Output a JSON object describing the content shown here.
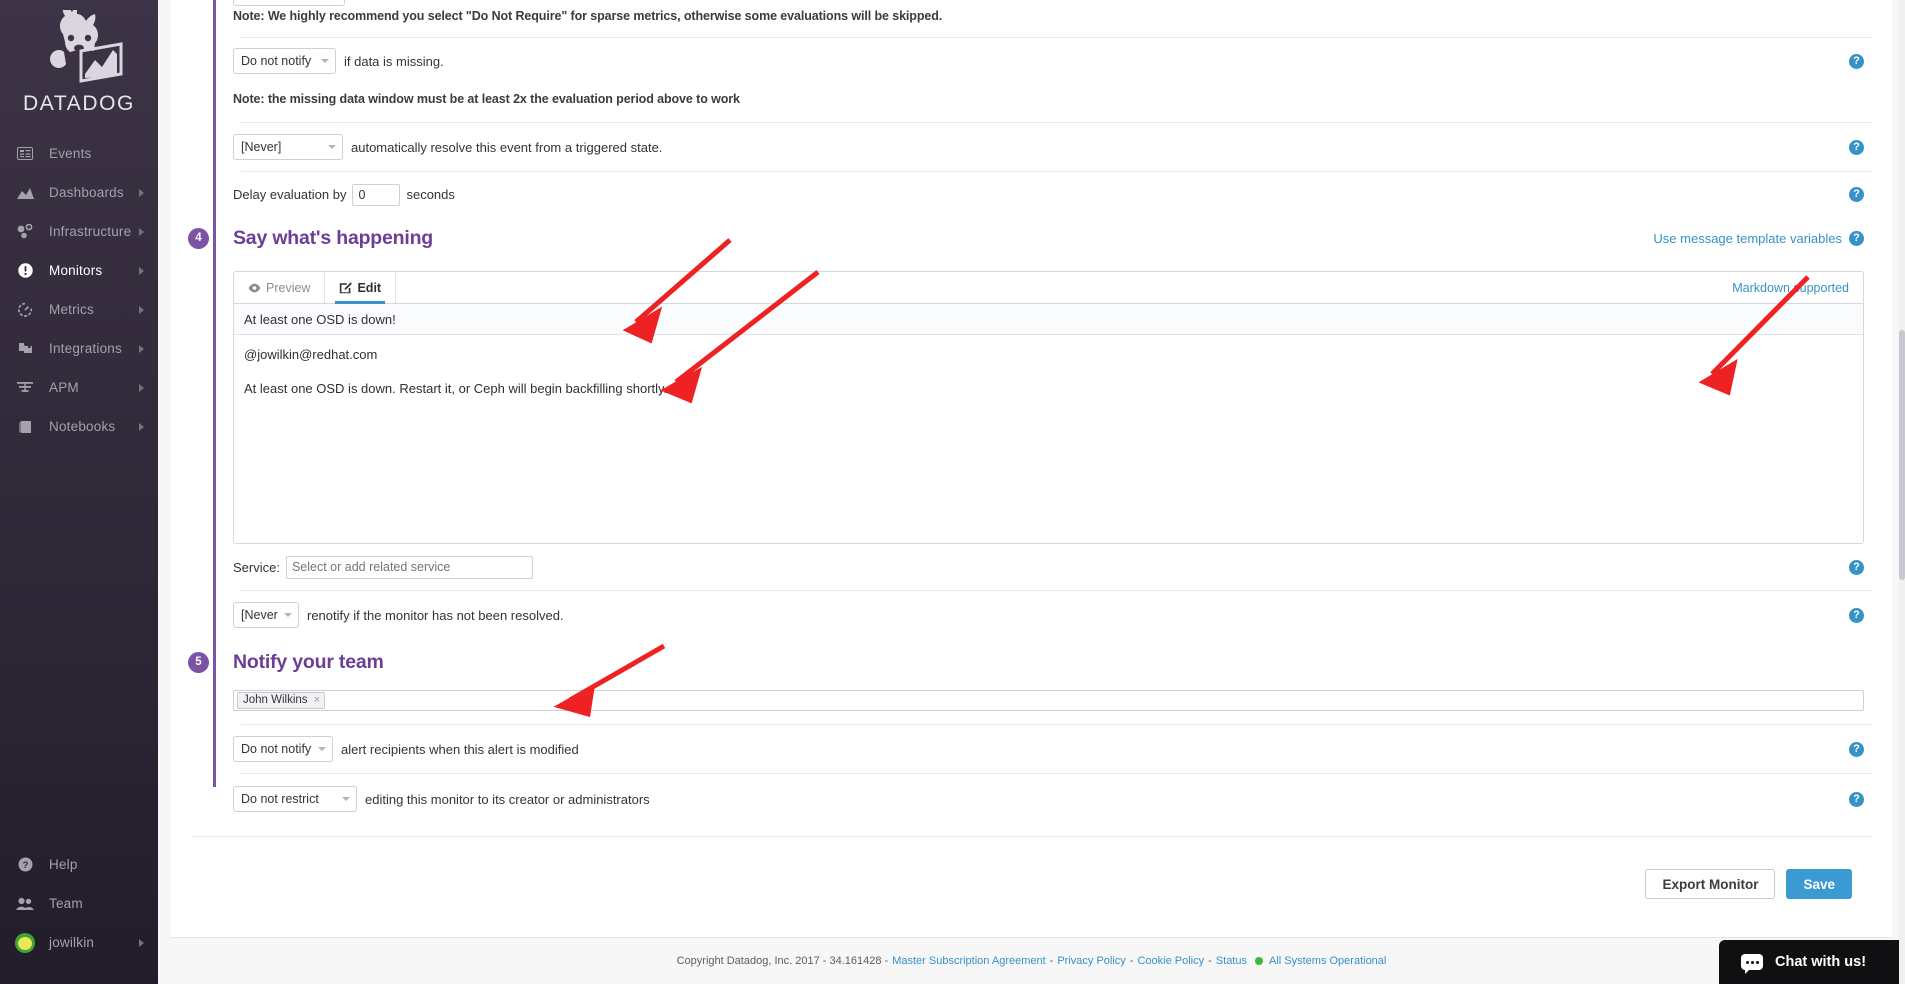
{
  "sidebar": {
    "brand": "DATADOG",
    "items": [
      {
        "label": "Events",
        "icon": "events-icon",
        "has_caret": false,
        "active": false
      },
      {
        "label": "Dashboards",
        "icon": "dashboards-icon",
        "has_caret": true,
        "active": false
      },
      {
        "label": "Infrastructure",
        "icon": "infrastructure-icon",
        "has_caret": true,
        "active": false
      },
      {
        "label": "Monitors",
        "icon": "monitors-icon",
        "has_caret": true,
        "active": true
      },
      {
        "label": "Metrics",
        "icon": "metrics-icon",
        "has_caret": true,
        "active": false
      },
      {
        "label": "Integrations",
        "icon": "integrations-icon",
        "has_caret": true,
        "active": false
      },
      {
        "label": "APM",
        "icon": "apm-icon",
        "has_caret": true,
        "active": false
      },
      {
        "label": "Notebooks",
        "icon": "notebooks-icon",
        "has_caret": true,
        "active": false
      }
    ],
    "bottom_items": [
      {
        "label": "Help",
        "icon": "help-circle-icon",
        "has_caret": false
      },
      {
        "label": "Team",
        "icon": "team-icon",
        "has_caret": false
      },
      {
        "label": "jowilkin",
        "icon": "user-avatar",
        "has_caret": true
      }
    ]
  },
  "notes": {
    "sparse_metrics": "Note: We highly recommend you select \"Do Not Require\" for sparse metrics, otherwise some evaluations will be skipped.",
    "missing_data_window": "Note: the missing data window must be at least 2x the evaluation period above to work"
  },
  "missing_data_row": {
    "select_value": "Do not notify",
    "text": "if data is missing."
  },
  "auto_resolve_row": {
    "select_value": "[Never]",
    "text": "automatically resolve this event from a triggered state."
  },
  "delay_row": {
    "label_before": "Delay evaluation by",
    "value": "0",
    "label_after": "seconds"
  },
  "step4": {
    "number": "4",
    "title": "Say what's happening",
    "template_link": "Use message template variables",
    "markdown_note": "Markdown supported",
    "tabs": [
      {
        "label": "Preview",
        "icon": "eye-icon",
        "active": false
      },
      {
        "label": "Edit",
        "icon": "pencil-icon",
        "active": true
      }
    ],
    "message_title": "At least one OSD is down!",
    "message_body_lines": [
      "@jowilkin@redhat.com",
      "At least one OSD is down. Restart it, or Ceph will begin backfilling shortly."
    ],
    "service_label": "Service:",
    "service_placeholder": "Select or add related service",
    "service_value": "",
    "renotify_select": "[Never]",
    "renotify_text": "renotify if the monitor has not been resolved."
  },
  "step5": {
    "number": "5",
    "title": "Notify your team",
    "recipients": [
      {
        "name": "John Wilkins",
        "remove": "×"
      }
    ],
    "modify_notify_select": "Do not notify",
    "modify_notify_text": "alert recipients when this alert is modified",
    "restrict_select": "Do not restrict",
    "restrict_text": "editing this monitor to its creator or administrators"
  },
  "actions": {
    "export_label": "Export Monitor",
    "save_label": "Save"
  },
  "footer": {
    "copyright": "Copyright Datadog, Inc. 2017 - 34.161428 -",
    "links": [
      "Master Subscription Agreement",
      "Privacy Policy",
      "Cookie Policy",
      "Status"
    ],
    "separator": "-",
    "status_text": "All Systems Operational"
  },
  "chat": {
    "label": "Chat with us!"
  },
  "icons": {
    "help": "?"
  },
  "colors": {
    "brand_purple": "#7c52a5",
    "step_title_purple": "#6b3f96",
    "link_blue": "#3792c8",
    "save_blue": "#3a9ad1",
    "status_green": "#41b73e",
    "annotation_red": "#ee2222",
    "sidebar_dark": "#312a3a"
  }
}
